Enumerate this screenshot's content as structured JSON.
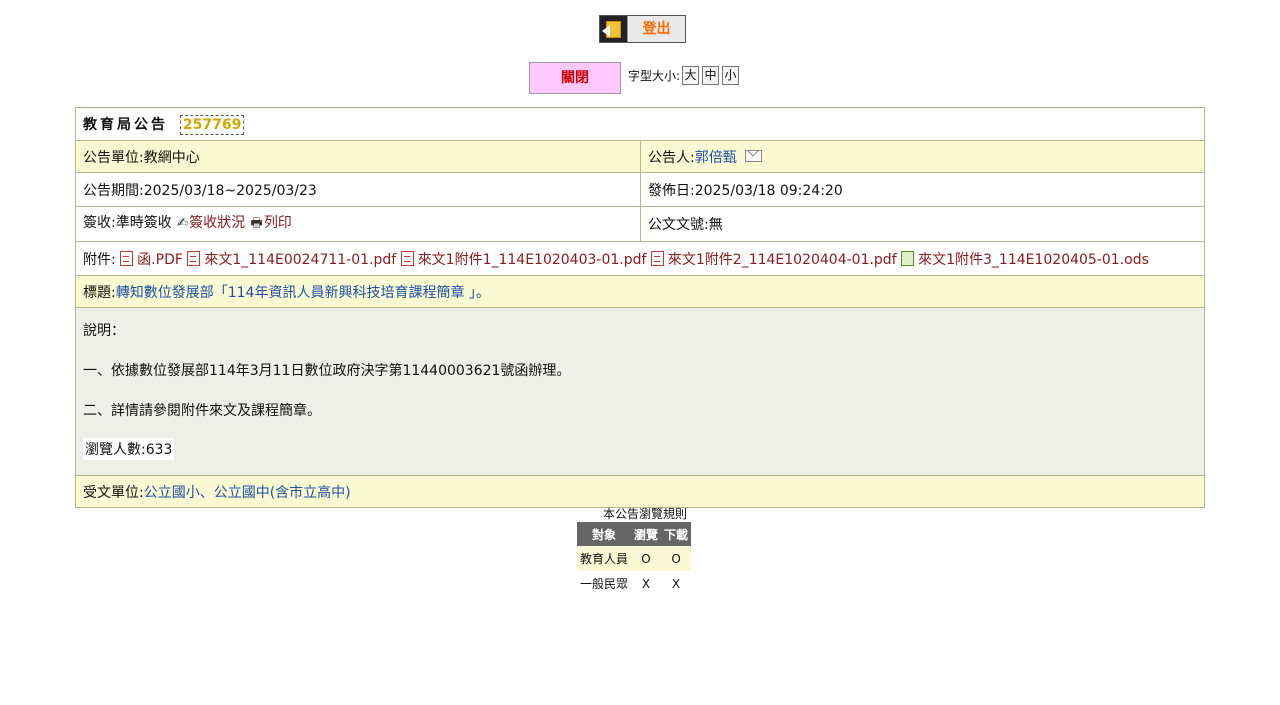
{
  "logout": {
    "label": "登出",
    "icon": "logout-icon"
  },
  "toolbar": {
    "close_label": "關閉",
    "font_size_label": "字型大小:",
    "font_sizes": [
      "大",
      "中",
      "小"
    ]
  },
  "announcement": {
    "heading": "教育局公告",
    "id": "257769",
    "unit_label": "公告單位:",
    "unit": "教網中心",
    "announcer_label": "公告人:",
    "announcer": "郭倍甄",
    "period_label": "公告期間:",
    "period": "2025/03/18~2025/03/23",
    "publish_label": "發佈日:",
    "publish_date": "2025/03/18 09:24:20",
    "sign_label": "簽收:",
    "sign_value": "準時簽收",
    "sign_status": "簽收狀況",
    "print": "列印",
    "doc_no_label": "公文文號:",
    "doc_no": "無",
    "attachments_label": "附件:",
    "attachments": [
      {
        "name": "函.PDF",
        "icon": "pdf-icon"
      },
      {
        "name": "來文1_114E0024711-01.pdf",
        "icon": "pdf-icon"
      },
      {
        "name": "來文1附件1_114E1020403-01.pdf",
        "icon": "pdf-icon"
      },
      {
        "name": "來文1附件2_114E1020404-01.pdf",
        "icon": "pdf-icon"
      },
      {
        "name": "來文1附件3_114E1020405-01.ods",
        "icon": "ods-icon"
      }
    ],
    "title_label": "標題:",
    "title": "轉知數位發展部「114年資訊人員新興科技培育課程簡章 」。",
    "body": [
      "說明：",
      "一、依據數位發展部114年3月11日數位政府決字第11440003621號函辦理。",
      "二、詳情請參閱附件來文及課程簡章。"
    ],
    "views_label": "瀏覽人數:",
    "views": "633",
    "recipients_label": "受文單位:",
    "recipients": "公立國小、公立國中(含市立高中)"
  },
  "rules": {
    "title": "本公告瀏覽規則",
    "headers": [
      "對象",
      "瀏覽",
      "下載"
    ],
    "rows": [
      [
        "教育人員",
        "O",
        "O"
      ],
      [
        "一般民眾",
        "X",
        "X"
      ]
    ]
  }
}
